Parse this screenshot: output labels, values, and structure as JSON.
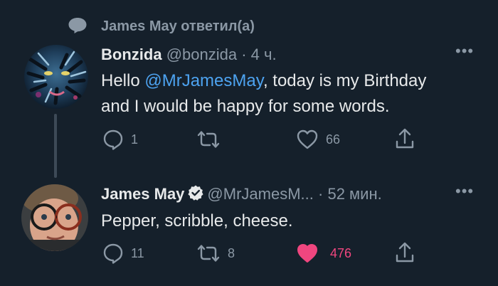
{
  "reply_context": {
    "text": "James May ответил(а)"
  },
  "tweets": [
    {
      "author": {
        "name": "Bonzida",
        "handle": "@bonzida"
      },
      "separator": "·",
      "time": "4 ч.",
      "body": {
        "before": "Hello ",
        "mention": "@MrJamesMay",
        "after_line1": ", today is my Birthday",
        "line2": "and I would be happy for some words."
      },
      "actions": {
        "reply_count": "1",
        "retweet_count": "",
        "like_count": "66",
        "liked": false
      }
    },
    {
      "author": {
        "name": "James May",
        "handle": "@MrJamesM...",
        "verified": true
      },
      "separator": "·",
      "time": "52 мин.",
      "body": {
        "text": "Pepper, scribble, cheese."
      },
      "actions": {
        "reply_count": "11",
        "retweet_count": "8",
        "like_count": "476",
        "liked": true
      }
    }
  ],
  "icons": [
    "speech-bubble-icon",
    "reply-icon",
    "retweet-icon",
    "heart-icon",
    "share-icon",
    "more-icon",
    "verified-badge-icon"
  ],
  "colors": {
    "background": "#15202b",
    "text": "#e7e9ea",
    "muted": "#8b98a5",
    "link": "#4da3f0",
    "like": "#f0467f"
  }
}
